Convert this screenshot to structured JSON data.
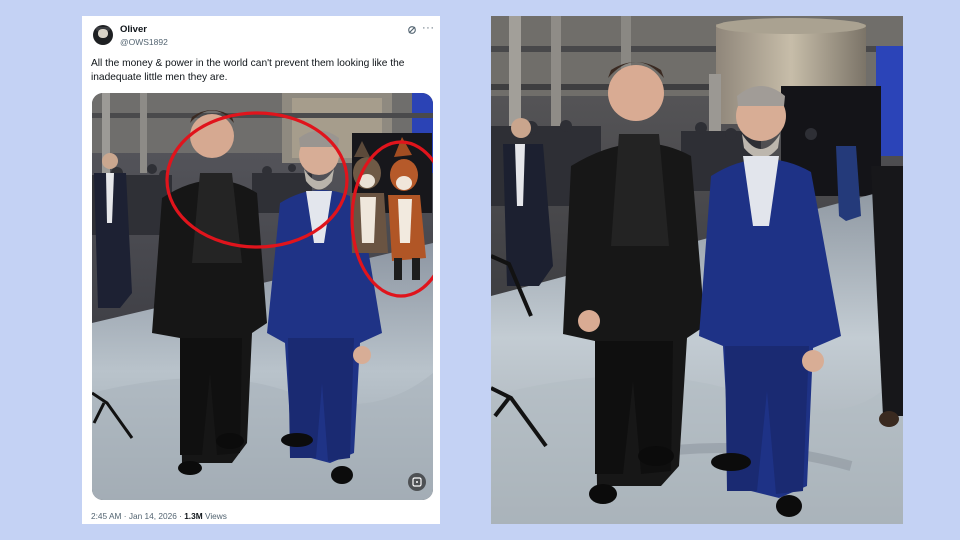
{
  "tweet": {
    "display_name": "Oliver",
    "handle": "@OWS1892",
    "text": "All the money & power in the world can't prevent them looking like the inadequate little men they are.",
    "time": "2:45 AM",
    "separator": " · ",
    "date": "Jan 14, 2026",
    "views_count": "1.3M",
    "views_label": " Views",
    "more_icon": "···"
  },
  "annotations": {
    "circle_color": "#e0141c"
  },
  "colors": {
    "background": "#c4d2f4",
    "suit_navy": "#1c2d78",
    "jacket_black": "#1a1a1a"
  }
}
